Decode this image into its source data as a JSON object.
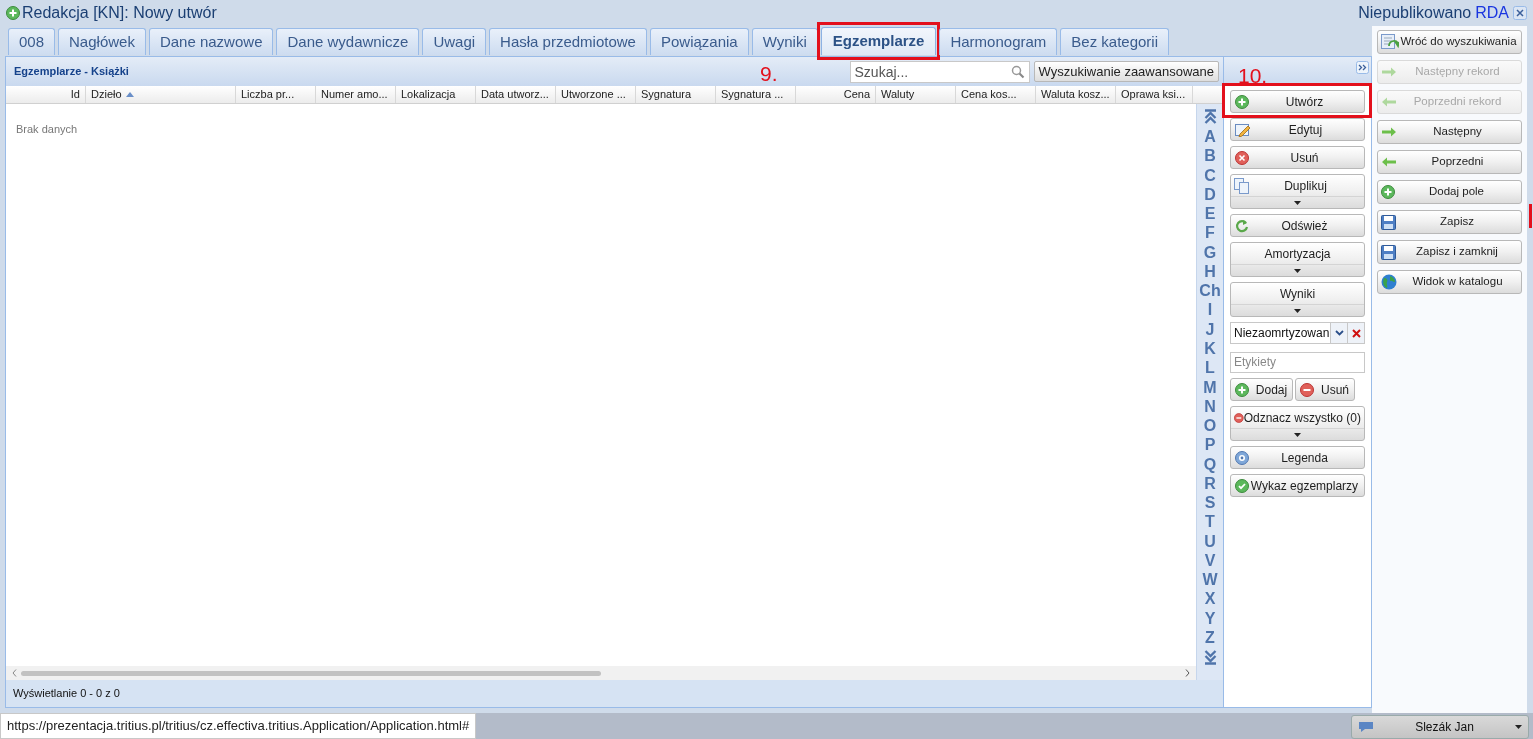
{
  "window": {
    "title": "Redakcja [KN]: Nowy utwór",
    "status": "Niepublikowano",
    "format": "RDA"
  },
  "tabs": [
    {
      "label": "008",
      "selected": false,
      "highlighted": false
    },
    {
      "label": "Nagłówek",
      "selected": false,
      "highlighted": false
    },
    {
      "label": "Dane nazwowe",
      "selected": false,
      "highlighted": false
    },
    {
      "label": "Dane wydawnicze",
      "selected": false,
      "highlighted": false
    },
    {
      "label": "Uwagi",
      "selected": false,
      "highlighted": false
    },
    {
      "label": "Hasła przedmiotowe",
      "selected": false,
      "highlighted": false
    },
    {
      "label": "Powiązania",
      "selected": false,
      "highlighted": false
    },
    {
      "label": "Wyniki",
      "selected": false,
      "highlighted": false
    },
    {
      "label": "Egzemplarze",
      "selected": true,
      "highlighted": true
    },
    {
      "label": "Harmonogram",
      "selected": false,
      "highlighted": false
    },
    {
      "label": "Bez kategorii",
      "selected": false,
      "highlighted": false
    }
  ],
  "annotations": [
    {
      "label": "9."
    },
    {
      "label": "10."
    }
  ],
  "panel": {
    "title": "Egzemplarze - Książki",
    "search": {
      "placeholder": "Szukaj..."
    },
    "advanced_search": "Wyszukiwanie zaawansowane"
  },
  "table": {
    "columns": [
      {
        "label": "Id",
        "numeric": true,
        "sorted": false
      },
      {
        "label": "Dzieło",
        "numeric": false,
        "sorted": true
      },
      {
        "label": "Liczba pr...",
        "numeric": false,
        "sorted": false
      },
      {
        "label": "Numer amo...",
        "numeric": false,
        "sorted": false
      },
      {
        "label": "Lokalizacja",
        "numeric": false,
        "sorted": false
      },
      {
        "label": "Data utworz...",
        "numeric": false,
        "sorted": false
      },
      {
        "label": "Utworzone ...",
        "numeric": false,
        "sorted": false
      },
      {
        "label": "Sygnatura",
        "numeric": false,
        "sorted": false
      },
      {
        "label": "Sygnatura ...",
        "numeric": false,
        "sorted": false
      },
      {
        "label": "Cena",
        "numeric": true,
        "sorted": false
      },
      {
        "label": "Waluty",
        "numeric": false,
        "sorted": false
      },
      {
        "label": "Cena kos...",
        "numeric": false,
        "sorted": false
      },
      {
        "label": "Waluta kosz...",
        "numeric": false,
        "sorted": false
      },
      {
        "label": "Oprawa ksi...",
        "numeric": false,
        "sorted": false
      }
    ],
    "empty_text": "Brak danych",
    "footer": "Wyświetlanie 0 - 0 z 0"
  },
  "alphabet": [
    "A",
    "B",
    "C",
    "D",
    "E",
    "F",
    "G",
    "H",
    "Ch",
    "I",
    "J",
    "K",
    "L",
    "M",
    "N",
    "O",
    "P",
    "Q",
    "R",
    "S",
    "T",
    "U",
    "V",
    "W",
    "X",
    "Y",
    "Z"
  ],
  "actions": [
    {
      "kind": "button",
      "label": "Utwórz",
      "highlighted": true
    },
    {
      "kind": "button",
      "label": "Edytuj",
      "highlighted": false
    },
    {
      "kind": "button",
      "label": "Usuń",
      "highlighted": false
    },
    {
      "kind": "split",
      "label": "Duplikuj",
      "highlighted": false
    },
    {
      "kind": "button",
      "label": "Odśwież",
      "highlighted": false
    },
    {
      "kind": "split",
      "label": "Amortyzacja",
      "highlighted": false
    },
    {
      "kind": "split",
      "label": "Wyniki",
      "highlighted": false
    },
    {
      "kind": "combo",
      "value": "Niezaomrtyzowan",
      "highlighted": false
    },
    {
      "kind": "field",
      "placeholder": "Etykiety",
      "highlighted": false
    },
    {
      "kind": "pair",
      "buttons": [
        {
          "label": "Dodaj"
        },
        {
          "label": "Usuń"
        }
      ],
      "highlighted": false
    },
    {
      "kind": "split",
      "label": "Odznacz wszystko (0)",
      "highlighted": false
    },
    {
      "kind": "button",
      "label": "Legenda",
      "highlighted": false
    },
    {
      "kind": "button",
      "label": "Wykaz egzemplarzy",
      "highlighted": false
    }
  ],
  "record_buttons": [
    {
      "label": "Wróć do wyszukiwania",
      "disabled": false
    },
    {
      "label": "Następny rekord",
      "disabled": true
    },
    {
      "label": "Poprzedni rekord",
      "disabled": true
    },
    {
      "label": "Następny",
      "disabled": false
    },
    {
      "label": "Poprzedni",
      "disabled": false
    },
    {
      "label": "Dodaj pole",
      "disabled": false
    },
    {
      "label": "Zapisz",
      "disabled": false
    },
    {
      "label": "Zapisz i zamknij",
      "disabled": false
    },
    {
      "label": "Widok w katalogu",
      "disabled": false
    }
  ],
  "status_bar": {
    "url": "https://prezentacja.tritius.pl/tritius/cz.effectiva.tritius.Application/Application.html#",
    "user": "Slezák Jan"
  }
}
